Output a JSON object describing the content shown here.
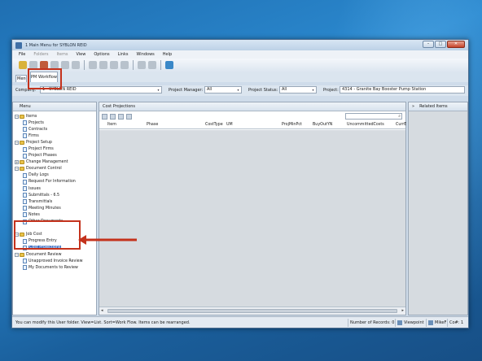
{
  "window": {
    "title": "1 Main Menu for SYBLON REID",
    "minimize": "–",
    "maximize": "□",
    "close": "✕"
  },
  "menubar": {
    "items": [
      "File",
      "Folders",
      "Items",
      "View",
      "Options",
      "Links",
      "Windows",
      "Help"
    ]
  },
  "tabs": {
    "menu_tab": "Menu",
    "pm_tab": "PM Workflow"
  },
  "filters": {
    "company_label": "Company:",
    "company_value": "1 - SYBLON REID",
    "pm_label": "Project Manager:",
    "pm_value": "All",
    "status_label": "Project Status:",
    "status_value": "All",
    "project_label": "Project:",
    "project_value": "4314 - Granite Bay Booster Pump Station"
  },
  "left_panel": {
    "header": "Menu",
    "tree": [
      {
        "label": "Items",
        "type": "folder",
        "level": 0,
        "expander": "−"
      },
      {
        "label": "Projects",
        "type": "doc",
        "level": 1
      },
      {
        "label": "Contracts",
        "type": "doc",
        "level": 1
      },
      {
        "label": "Firms",
        "type": "doc",
        "level": 1
      },
      {
        "label": "Project Setup",
        "type": "folder",
        "level": 0,
        "expander": "−"
      },
      {
        "label": "Project Firms",
        "type": "doc",
        "level": 1
      },
      {
        "label": "Project Phases",
        "type": "doc",
        "level": 1
      },
      {
        "label": "Change Management",
        "type": "folder",
        "level": 0,
        "expander": "+"
      },
      {
        "label": "Document Control",
        "type": "folder",
        "level": 0,
        "expander": "−"
      },
      {
        "label": "Daily Logs",
        "type": "doc",
        "level": 1
      },
      {
        "label": "Request For Information",
        "type": "doc",
        "level": 1
      },
      {
        "label": "Issues",
        "type": "doc",
        "level": 1
      },
      {
        "label": "Submittals - 6.5",
        "type": "doc",
        "level": 1
      },
      {
        "label": "Transmittals",
        "type": "doc",
        "level": 1
      },
      {
        "label": "Meeting Minutes",
        "type": "doc",
        "level": 1
      },
      {
        "label": "Notes",
        "type": "doc",
        "level": 1
      },
      {
        "label": "Other Documents",
        "type": "doc",
        "level": 1
      },
      {
        "label": "",
        "type": "spacer",
        "level": 0
      },
      {
        "label": "Job Cost",
        "type": "folder",
        "level": 0,
        "expander": "−"
      },
      {
        "label": "Progress Entry",
        "type": "doc",
        "level": 1
      },
      {
        "label": "Cost Projections",
        "type": "doc",
        "level": 1,
        "selected": true
      },
      {
        "label": "Document Review",
        "type": "folder",
        "level": 0,
        "expander": "−"
      },
      {
        "label": "Unapproved Invoice Review",
        "type": "doc",
        "level": 1
      },
      {
        "label": "My Documents to Review",
        "type": "doc",
        "level": 1
      }
    ]
  },
  "main": {
    "header": "Cost Projections",
    "search_icon_glyph": "⌕",
    "columns": [
      "Item",
      "Phase",
      "CostType",
      "UM",
      "ProjMinPct",
      "BuyOutYN",
      "UncommittedCosts",
      "CurrE"
    ]
  },
  "related": {
    "collapse_glyph": "»",
    "header": "Related Items"
  },
  "statusbar": {
    "message": "You can modify this User folder. View=List. Sort=Work Flow. Items can be rearranged.",
    "records": "Number of Records: 0",
    "server": "Viewpoint",
    "user": "MikeF",
    "company": "Co#: 1"
  },
  "colors": {
    "annotation_red": "#c4321c",
    "selection_blue": "#3a6fc4"
  }
}
